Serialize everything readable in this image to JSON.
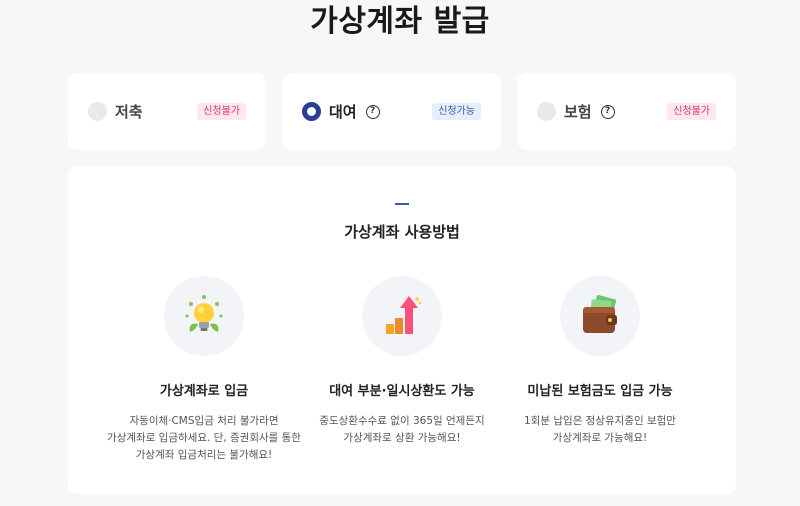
{
  "header": {
    "title": "가상계좌 발급"
  },
  "options": [
    {
      "label": "저축",
      "badge": "신청불가",
      "selected": false,
      "help": false
    },
    {
      "label": "대여",
      "badge": "신청가능",
      "selected": true,
      "help": true
    },
    {
      "label": "보험",
      "badge": "신청불가",
      "selected": false,
      "help": true
    }
  ],
  "help_glyph": "?",
  "usage": {
    "title": "가상계좌 사용방법",
    "features": [
      {
        "icon": "lightbulb-icon",
        "title": "가상계좌로 입금",
        "desc": [
          "자동이체·CMS입금 처리 불가라면",
          "가상계좌로 입금하세요. 단, 증권회사를 통한",
          "가상계좌 입금처리는 불가해요!"
        ]
      },
      {
        "icon": "growth-chart-icon",
        "title": "대여 부분·일시상환도 가능",
        "desc": [
          "중도상환수수료 없이 365일 언제든지",
          "가상계좌로 상환 가능해요!"
        ]
      },
      {
        "icon": "wallet-icon",
        "title": "미납된 보험금도 입금 가능",
        "desc": [
          "1회분 납입은 정상유지중인 보험만",
          "가상계좌로 가능해요!"
        ]
      }
    ]
  },
  "colors": {
    "accent": "#2b3f98",
    "badge_unavailable_bg": "#fde8ee",
    "badge_unavailable_text": "#d8356b",
    "badge_available_bg": "#e6eefb",
    "badge_available_text": "#2f5fb3"
  }
}
